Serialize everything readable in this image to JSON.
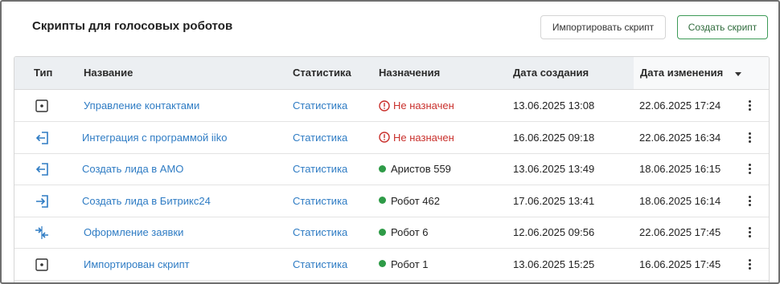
{
  "header": {
    "title": "Скрипты для голосовых роботов",
    "import_button": "Импортировать скрипт",
    "create_button": "Создать скрипт"
  },
  "table": {
    "columns": {
      "type": "Тип",
      "name": "Название",
      "stats": "Статистика",
      "assign": "Назначения",
      "created": "Дата создания",
      "modified": "Дата изменения"
    },
    "sort": {
      "column": "modified",
      "direction": "desc"
    },
    "rows": [
      {
        "icon": "script-icon",
        "name": "Управление контактами",
        "stats": "Статистика",
        "assign_state": "unassigned",
        "assign": "Не назначен",
        "created": "13.06.2025 13:08",
        "modified": "22.06.2025 17:24"
      },
      {
        "icon": "import-arrow-icon",
        "name": "Интеграция с программой iiko",
        "stats": "Статистика",
        "assign_state": "unassigned",
        "assign": "Не назначен",
        "created": "16.06.2025 09:18",
        "modified": "22.06.2025 16:34"
      },
      {
        "icon": "import-arrow-icon",
        "name": "Создать лида в АМО",
        "stats": "Статистика",
        "assign_state": "assigned",
        "assign": "Аристов 559",
        "created": "13.06.2025 13:49",
        "modified": "18.06.2025 16:15"
      },
      {
        "icon": "export-arrow-icon",
        "name": "Создать лида в Битрикс24",
        "stats": "Статистика",
        "assign_state": "assigned",
        "assign": "Робот 462",
        "created": "17.06.2025 13:41",
        "modified": "18.06.2025 16:14"
      },
      {
        "icon": "exchange-arrows-icon",
        "name": "Оформление заявки",
        "stats": "Статистика",
        "assign_state": "assigned",
        "assign": "Робот 6",
        "created": "12.06.2025 09:56",
        "modified": "22.06.2025 17:45"
      },
      {
        "icon": "script-icon",
        "name": "Импортирован  скрипт",
        "stats": "Статистика",
        "assign_state": "assigned",
        "assign": "Робот 1",
        "created": "13.06.2025 15:25",
        "modified": "16.06.2025 17:45"
      }
    ]
  },
  "colors": {
    "link": "#2f7cc4",
    "danger": "#c9302c",
    "success": "#2e9b47",
    "create_border": "#3d9a57"
  }
}
